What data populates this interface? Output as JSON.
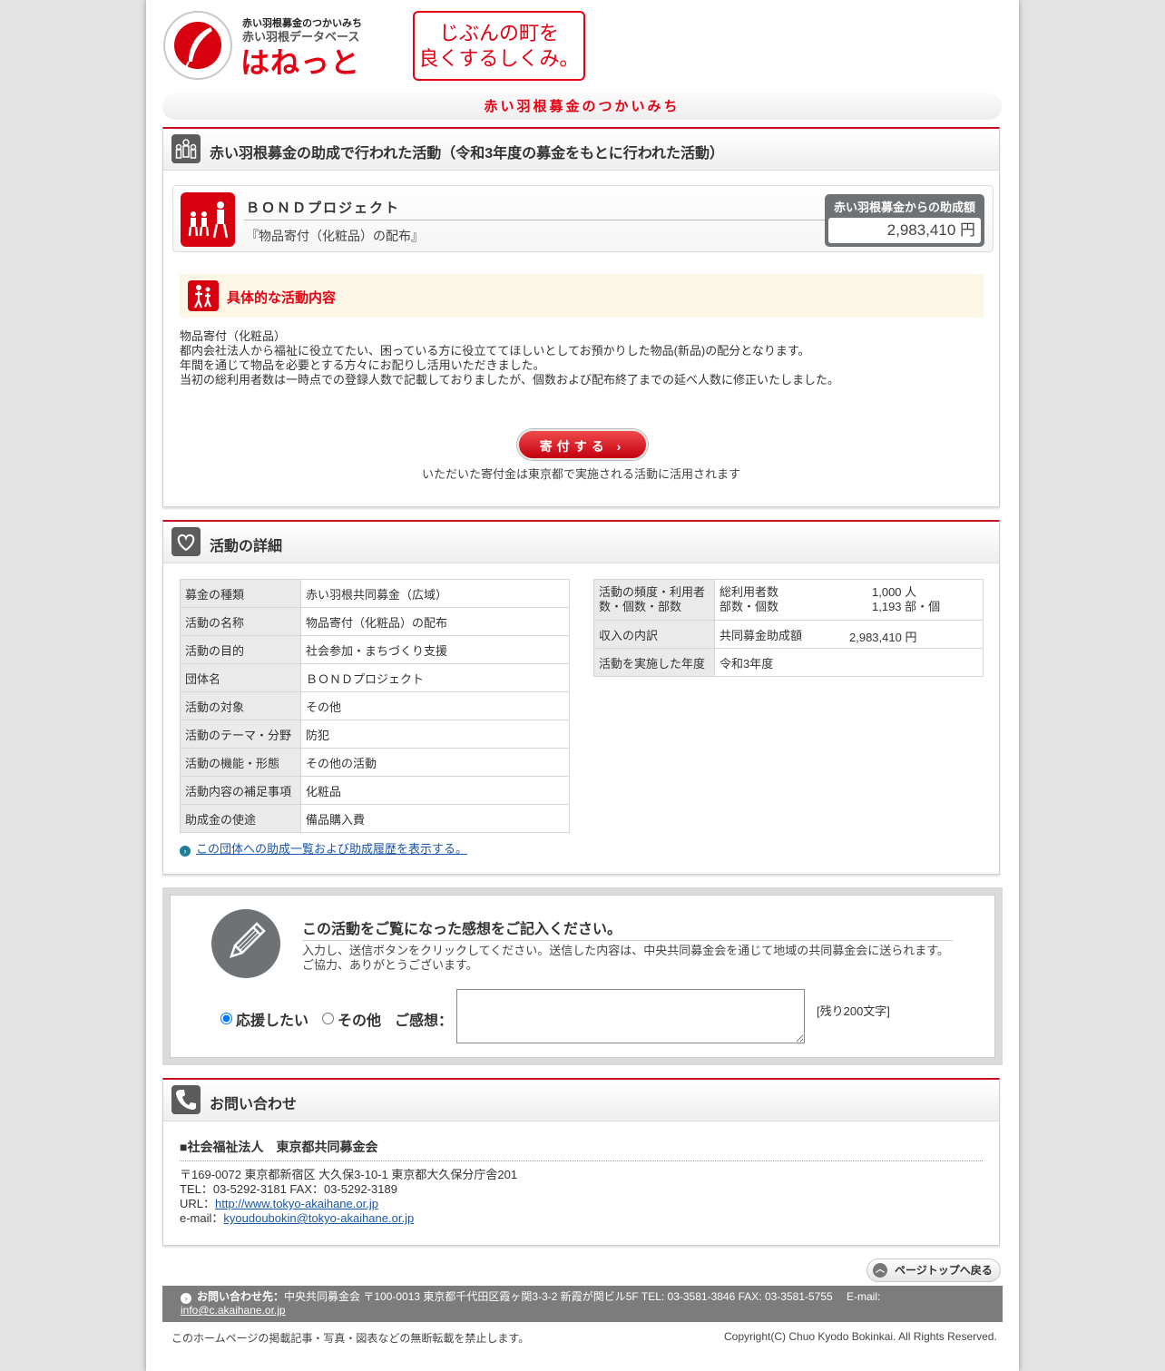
{
  "header": {
    "logo_line1": "赤い羽根募金のつかいみち",
    "logo_line2": "赤い羽根データベース",
    "logo_main": "はねっと",
    "slogan_line1": "じぶんの町を",
    "slogan_line2": "良くするしくみ。",
    "title": "赤い羽根募金のつかいみち"
  },
  "activity": {
    "heading": "赤い羽根募金の助成で行われた活動（令和3年度の募金をもとに行われた活動）",
    "org_name": "ＢＯＮＤプロジェクト",
    "project_name": "『物品寄付（化粧品）の配布』",
    "grant_label": "赤い羽根募金からの助成額",
    "grant_amount": "2,983,410 円",
    "specifics_title": "具体的な活動内容",
    "description": [
      "物品寄付（化粧品）",
      "都内会社法人から福祉に役立てたい、困っている方に役立ててほしいとしてお預かりした物品(新品)の配分となります。",
      "年間を通じて物品を必要とする方々にお配りし活用いただきました。",
      "当初の総利用者数は一時点での登録人数で記載しておりましたが、個数および配布終了までの延べ人数に修正いたしました。"
    ],
    "donate_label": "寄付する ›",
    "donate_note": "いただいた寄付金は東京都で実施される活動に活用されます"
  },
  "details": {
    "heading": "活動の詳細",
    "left_rows": [
      {
        "key": "募金の種類",
        "value": "赤い羽根共同募金（広域）"
      },
      {
        "key": "活動の名称",
        "value": "物品寄付（化粧品）の配布"
      },
      {
        "key": "活動の目的",
        "value": "社会参加・まちづくり支援"
      },
      {
        "key": "団体名",
        "value": "ＢＯＮＤプロジェクト"
      },
      {
        "key": "活動の対象",
        "value": "その他"
      },
      {
        "key": "活動のテーマ・分野",
        "value": "防犯"
      },
      {
        "key": "活動の機能・形態",
        "value": "その他の活動"
      },
      {
        "key": "活動内容の補足事項",
        "value": "化粧品"
      },
      {
        "key": "助成金の使途",
        "value": "備品購入費"
      }
    ],
    "right": {
      "freq_key_1": "活動の頻度・利用者",
      "freq_key_2": "数・個数・部数",
      "users_label": "総利用者数",
      "users_value": "1,000 人",
      "count_label": "部数・個数",
      "count_value": "1,193 部・個",
      "income_key": "収入の内訳",
      "income_label": "共同募金助成額",
      "income_value": "2,983,410 円",
      "year_key": "活動を実施した年度",
      "year_value": "令和3年度"
    },
    "history_link": "この団体への助成一覧および助成履歴を表示する。"
  },
  "feedback": {
    "title": "この活動をご覧になった感想をご記入ください。",
    "text1": "入力し、送信ボタンをクリックしてください。送信した内容は、中央共同募金会を通じて地域の共同募金会に送られます。",
    "text2": "ご協力、ありがとうございます。",
    "radio_support": "応援したい",
    "radio_other": "その他",
    "comment_label": "ご感想：",
    "remaining": "[残り200文字]"
  },
  "contact": {
    "heading": "お問い合わせ",
    "org": "■社会福祉法人　東京都共同募金会",
    "address": "〒169-0072 東京都新宿区 大久保3-10-1 東京都大久保分庁舎201",
    "tel_fax": "TEL：03-5292-3181 FAX：03-5292-3189",
    "url_label": "URL：",
    "url": "http://www.tokyo-akaihane.or.jp",
    "email_label": "e-mail：",
    "email": "kyoudoubokin@tokyo-akaihane.or.jp"
  },
  "footer": {
    "pagetop": "ページトップへ戻る",
    "contact_label": "お問い合わせ先：",
    "contact_text": "中央共同募金会 〒100-0013 東京都千代田区霞ヶ関3-3-2 新霞が関ビル5F TEL: 03-3581-3846 FAX: 03-3581-5755　 E-mail:",
    "contact_email": "info@c.akaihane.or.jp",
    "notice": "このホームページの掲載記事・写真・図表などの無断転載を禁止します。",
    "copyright": "Copyright(C) Chuo Kyodo Bokinkai. All Rights Reserved."
  }
}
